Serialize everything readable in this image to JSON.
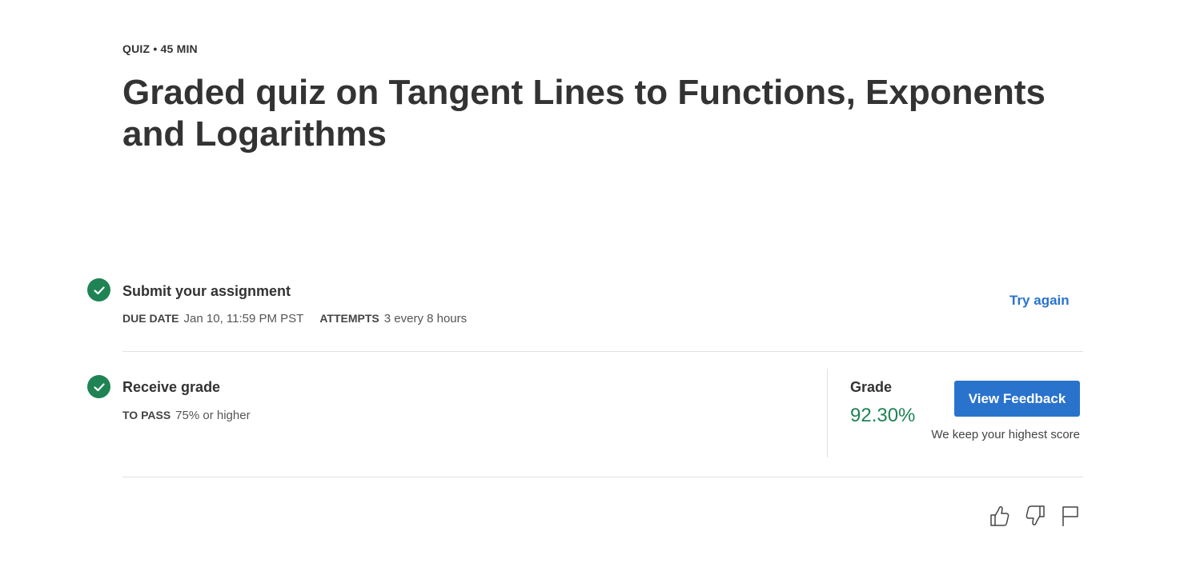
{
  "header": {
    "eyebrow": "QUIZ • 45 MIN",
    "title": "Graded quiz on Tangent Lines to Functions, Exponents and Logarithms"
  },
  "submit": {
    "title": "Submit your assignment",
    "due_label": "DUE DATE",
    "due_value": "Jan 10, 11:59 PM PST",
    "attempts_label": "ATTEMPTS",
    "attempts_value": "3 every 8 hours",
    "try_again": "Try again"
  },
  "receive": {
    "title": "Receive grade",
    "pass_label": "TO PASS",
    "pass_value": "75% or higher",
    "grade_label": "Grade",
    "grade_value": "92.30%",
    "feedback_button": "View Feedback",
    "note": "We keep your highest score"
  },
  "footer_icons": [
    "thumbs-up-icon",
    "thumbs-down-icon",
    "flag-icon"
  ],
  "colors": {
    "accent": "#2a73cc",
    "success": "#1f8354",
    "text": "#333333"
  }
}
